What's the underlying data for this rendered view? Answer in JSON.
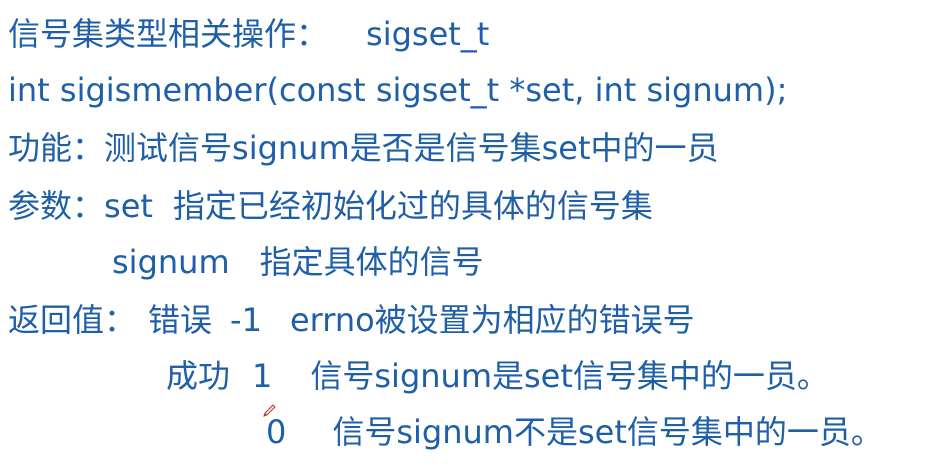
{
  "colors": {
    "text": "#1f5fa8",
    "background": "#ffffff"
  },
  "line1": {
    "label": "信号集类型相关操作：",
    "value": "sigset_t"
  },
  "line2": {
    "text": "int sigismember(const sigset_t *set, int signum);"
  },
  "line3": {
    "label": "功能：",
    "text": "测试信号signum是否是信号集set中的一员"
  },
  "line4": {
    "label": "参数：",
    "param": "set",
    "desc": "指定已经初始化过的具体的信号集"
  },
  "line5": {
    "param": "signum",
    "desc": "指定具体的信号"
  },
  "line6": {
    "label": "返回值：",
    "status": "错误",
    "code": "-1",
    "desc": "errno被设置为相应的错误号"
  },
  "line7": {
    "status": "成功",
    "code": "1",
    "desc": "信号signum是set信号集中的一员。"
  },
  "line8": {
    "code": "0",
    "desc": "信号signum不是set信号集中的一员。"
  },
  "icons": {
    "cursor": "pen-cursor-icon"
  }
}
